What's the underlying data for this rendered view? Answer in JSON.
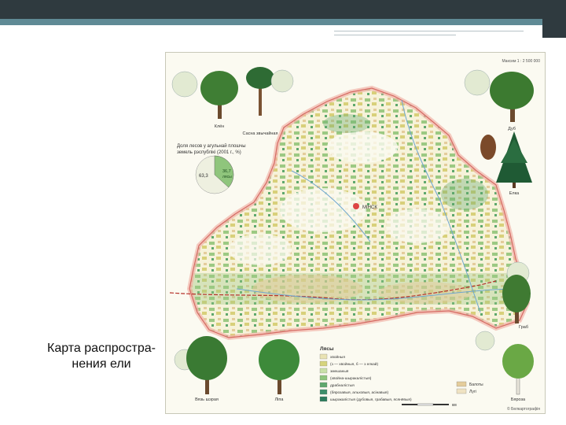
{
  "slide": {
    "caption_line1": "Карта распростра-",
    "caption_line2": "нения ели"
  },
  "map": {
    "corner_note_top": "Максим 1 : 2 500 000",
    "corner_note_bottom": "© Белкартографія",
    "pie_title": "Доля лесов у агульнай плошчы",
    "pie_title2": "земель рэспублікі (2001 г., %)",
    "pie_value_forest": "36,7",
    "pie_value_other": "63,3",
    "pie_label_forest": "лясы",
    "city_label": "МІНСК",
    "legend_title": "Лясы",
    "legend_items": [
      {
        "color": "#e9e3b3",
        "text": "хвойныя"
      },
      {
        "color": "#d6d47c",
        "text": "(з — хвойныя, б — з елкай)"
      },
      {
        "color": "#c9e0a8",
        "text": "змешаныя"
      },
      {
        "color": "#8fc57c",
        "text": "(хвойна-шыракалістыя)"
      },
      {
        "color": "#5ea86d",
        "text": "драбналістыя"
      },
      {
        "color": "#3d8f6a",
        "text": "(бярозавыя, альховыя, асінавыя)"
      },
      {
        "color": "#2d7c5d",
        "text": "шыракалістыя (дубовыя, грабавыя, ясянёвыя)"
      }
    ],
    "legend_right": [
      {
        "color": "#e4cc9b",
        "text": "Балоты"
      },
      {
        "color": "#efe2c2",
        "text": "Лугі"
      }
    ],
    "tree_labels": [
      "Клён",
      "Сасна звычайная",
      "Дуб",
      "Елка",
      "Граб",
      "Вязь шэрая",
      "Ліпа",
      "Бяроза"
    ],
    "scale_label": "км"
  },
  "colors": {
    "top_band": "#2f3a3f",
    "accent_band": "#5f8a95",
    "forest_green": "#8fc57c",
    "marsh": "#e4cc9b",
    "border_red": "#d66a64"
  }
}
